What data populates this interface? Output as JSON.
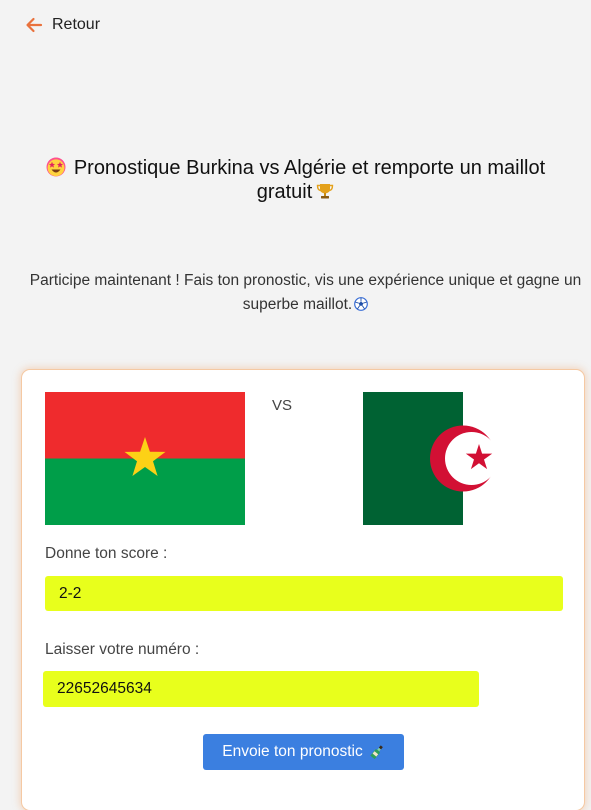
{
  "nav": {
    "back_label": "Retour",
    "back_icon": "arrow-left-icon",
    "accent_color": "#e9723d"
  },
  "header": {
    "title_line1": "Pronostique Burkina vs Algérie et remporte un maillot",
    "title_line2": "gratuit",
    "title_emoji_start": "star-struck-face-icon",
    "title_emoji_end": "trophy-icon"
  },
  "intro": {
    "text": "Participe maintenant ! Fais ton pronostic, vis une expérience unique et gagne un superbe maillot.",
    "emoji_end": "soccer-ball-icon"
  },
  "match": {
    "team_home": "Burkina Faso",
    "team_away": "Algérie",
    "vs_label": "VS",
    "home_flag_icon": "burkina-faso-flag-icon",
    "away_flag_icon": "algeria-flag-icon"
  },
  "form": {
    "score_label": "Donne ton score :",
    "score_value": "2-2",
    "phone_label": "Laisser votre numéro :",
    "phone_value": "22652645634",
    "input_highlight_color": "#e8ff1c",
    "submit_label": "Envoie ton pronostic",
    "submit_icon": "bottle-icon",
    "submit_color": "#3b7fe0"
  }
}
